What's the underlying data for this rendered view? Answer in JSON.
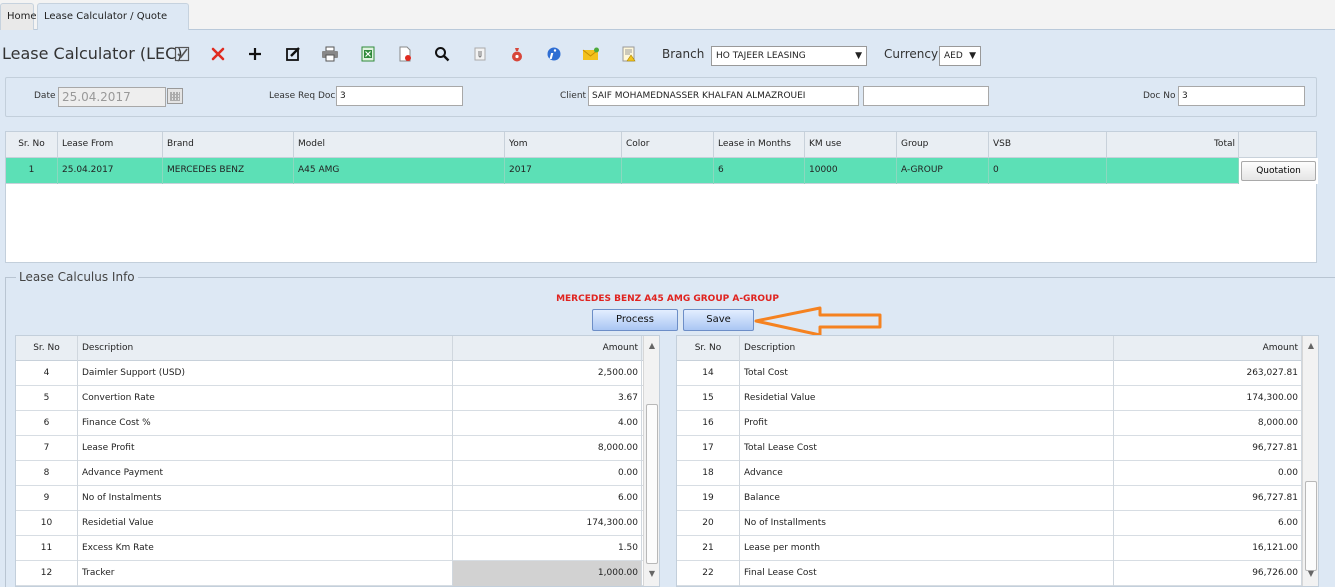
{
  "tabs": [
    {
      "label": "Home"
    },
    {
      "label": "Lease Calculator / Quote"
    }
  ],
  "toolbar": {
    "title": "Lease Calculator (LEC)",
    "branch_label": "Branch",
    "branch_value": "HO TAJEER LEASING",
    "currency_label": "Currency",
    "currency_value": "AED"
  },
  "header": {
    "date_label": "Date",
    "date_value": "25.04.2017",
    "lease_req_label": "Lease Req Doc",
    "lease_req_value": "3",
    "client_label": "Client",
    "client_value": "SAIF MOHAMEDNASSER KHALFAN ALMAZROUEI",
    "client_extra": "",
    "doc_no_label": "Doc No",
    "doc_no_value": "3"
  },
  "grid": {
    "columns": [
      "Sr. No",
      "Lease From",
      "Brand",
      "Model",
      "Yom",
      "Color",
      "Lease in Months",
      "KM use",
      "Group",
      "VSB",
      "Total"
    ],
    "row": {
      "sr": "1",
      "lease_from": "25.04.2017",
      "brand": "MERCEDES BENZ",
      "model": "A45 AMG",
      "yom": "2017",
      "color": "",
      "months": "6",
      "km": "10000",
      "group": "A-GROUP",
      "vsb": "0",
      "total": ""
    },
    "quotation_label": "Quotation"
  },
  "calculus": {
    "legend": "Lease Calculus Info",
    "subtitle": "MERCEDES BENZ A45 AMG GROUP A-GROUP",
    "process_label": "Process",
    "save_label": "Save",
    "headers": {
      "sr": "Sr. No",
      "desc": "Description",
      "amount": "Amount"
    },
    "left_rows": [
      {
        "sr": "4",
        "desc": "Daimler Support (USD)",
        "amount": "2,500.00"
      },
      {
        "sr": "5",
        "desc": "Convertion Rate",
        "amount": "3.67"
      },
      {
        "sr": "6",
        "desc": "Finance Cost %",
        "amount": "4.00"
      },
      {
        "sr": "7",
        "desc": "Lease Profit",
        "amount": "8,000.00"
      },
      {
        "sr": "8",
        "desc": "Advance Payment",
        "amount": "0.00"
      },
      {
        "sr": "9",
        "desc": "No of Instalments",
        "amount": "6.00"
      },
      {
        "sr": "10",
        "desc": "Residetial Value",
        "amount": "174,300.00"
      },
      {
        "sr": "11",
        "desc": "Excess Km Rate",
        "amount": "1.50"
      },
      {
        "sr": "12",
        "desc": "Tracker",
        "amount": "1,000.00"
      }
    ],
    "right_rows": [
      {
        "sr": "14",
        "desc": "Total Cost",
        "amount": "263,027.81"
      },
      {
        "sr": "15",
        "desc": "Residetial Value",
        "amount": "174,300.00"
      },
      {
        "sr": "16",
        "desc": "Profit",
        "amount": "8,000.00"
      },
      {
        "sr": "17",
        "desc": "Total Lease Cost",
        "amount": "96,727.81"
      },
      {
        "sr": "18",
        "desc": "Advance",
        "amount": "0.00"
      },
      {
        "sr": "19",
        "desc": "Balance",
        "amount": "96,727.81"
      },
      {
        "sr": "20",
        "desc": "No of Installments",
        "amount": "6.00"
      },
      {
        "sr": "21",
        "desc": "Lease per month",
        "amount": "16,121.00"
      },
      {
        "sr": "22",
        "desc": "Final Lease Cost",
        "amount": "96,726.00"
      }
    ]
  },
  "colors": {
    "selected_row": "#5ce0b6",
    "title_red": "#e0231f",
    "arrow_orange": "#f58220"
  }
}
